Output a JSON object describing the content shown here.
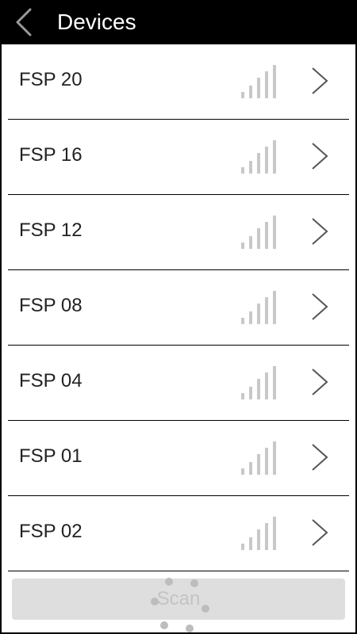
{
  "header": {
    "title": "Devices",
    "back_icon": "chevron-left-icon"
  },
  "devices": [
    {
      "name": "FSP 20"
    },
    {
      "name": "FSP 16"
    },
    {
      "name": "FSP 12"
    },
    {
      "name": "FSP 08"
    },
    {
      "name": "FSP 04"
    },
    {
      "name": "FSP 01"
    },
    {
      "name": "FSP 02"
    }
  ],
  "row_icons": {
    "signal": "signal-strength-icon",
    "chevron": "chevron-right-icon"
  },
  "scan": {
    "label": "Scan",
    "spinner_icon": "loading-spinner-icon"
  },
  "colors": {
    "header_bg": "#000000",
    "list_bg": "#ffffff",
    "divider": "#000000",
    "signal_bars": "#c8c8c8",
    "chevron": "#555555",
    "scan_bg": "#dedede",
    "scan_text": "#c4c4c4",
    "spinner_dots": "#bdbdbd"
  }
}
